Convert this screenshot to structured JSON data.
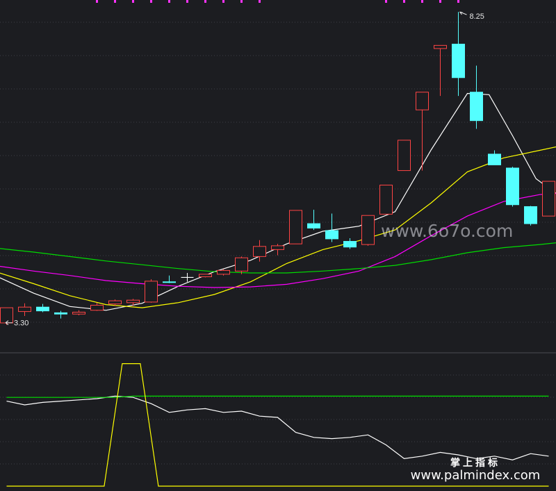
{
  "chart_data": [
    {
      "type": "candlestick",
      "panel": "price",
      "ylim": [
        3.0,
        8.35
      ],
      "grid": true,
      "annotations": {
        "high_label": "8.25",
        "low_label": "3.30",
        "high_value": 8.25,
        "low_value": 3.3
      },
      "candles": [
        {
          "o": 3.33,
          "c": 3.57,
          "h": 3.57,
          "l": 3.3
        },
        {
          "o": 3.51,
          "c": 3.58,
          "h": 3.64,
          "l": 3.44
        },
        {
          "o": 3.58,
          "c": 3.52,
          "h": 3.63,
          "l": 3.5
        },
        {
          "o": 3.49,
          "c": 3.47,
          "h": 3.52,
          "l": 3.4
        },
        {
          "o": 3.47,
          "c": 3.5,
          "h": 3.53,
          "l": 3.45
        },
        {
          "o": 3.53,
          "c": 3.61,
          "h": 3.65,
          "l": 3.52
        },
        {
          "o": 3.63,
          "c": 3.68,
          "h": 3.7,
          "l": 3.6
        },
        {
          "o": 3.65,
          "c": 3.69,
          "h": 3.71,
          "l": 3.6
        },
        {
          "o": 3.66,
          "c": 3.99,
          "h": 4.02,
          "l": 3.65
        },
        {
          "o": 3.98,
          "c": 3.97,
          "h": 4.08,
          "l": 3.96
        },
        {
          "o": 4.05,
          "c": 4.05,
          "h": 4.12,
          "l": 3.98
        },
        {
          "o": 4.06,
          "c": 4.1,
          "h": 4.1,
          "l": 4.05
        },
        {
          "o": 4.1,
          "c": 4.16,
          "h": 4.18,
          "l": 4.08
        },
        {
          "o": 4.15,
          "c": 4.36,
          "h": 4.38,
          "l": 4.1
        },
        {
          "o": 4.38,
          "c": 4.54,
          "h": 4.64,
          "l": 4.3
        },
        {
          "o": 4.49,
          "c": 4.55,
          "h": 4.58,
          "l": 4.4
        },
        {
          "o": 4.58,
          "c": 5.11,
          "h": 5.11,
          "l": 4.58
        },
        {
          "o": 4.9,
          "c": 4.83,
          "h": 5.12,
          "l": 4.8
        },
        {
          "o": 4.79,
          "c": 4.66,
          "h": 5.06,
          "l": 4.61
        },
        {
          "o": 4.62,
          "c": 4.53,
          "h": 4.67,
          "l": 4.5
        },
        {
          "o": 4.57,
          "c": 5.03,
          "h": 5.03,
          "l": 4.55
        },
        {
          "o": 5.05,
          "c": 5.51,
          "h": 5.51,
          "l": 5.05
        },
        {
          "o": 5.74,
          "c": 6.22,
          "h": 6.22,
          "l": 5.74
        },
        {
          "o": 6.7,
          "c": 6.98,
          "h": 6.98,
          "l": 5.74
        },
        {
          "o": 7.67,
          "c": 7.72,
          "h": 7.72,
          "l": 6.92
        },
        {
          "o": 7.74,
          "c": 7.21,
          "h": 8.25,
          "l": 6.92
        },
        {
          "o": 6.98,
          "c": 6.53,
          "h": 7.4,
          "l": 6.4
        },
        {
          "o": 6.0,
          "c": 5.83,
          "h": 6.06,
          "l": 5.83
        },
        {
          "o": 5.78,
          "c": 5.2,
          "h": 5.8,
          "l": 5.17
        },
        {
          "o": 5.17,
          "c": 4.9,
          "h": 5.18,
          "l": 4.87
        },
        {
          "o": 5.02,
          "c": 5.57,
          "h": 5.57,
          "l": 5.02
        }
      ],
      "ma": [
        {
          "color": "#ffffff",
          "points": [
            [
              -0.5,
              4.06
            ],
            [
              1.5,
              3.8
            ],
            [
              3.5,
              3.59
            ],
            [
              5.5,
              3.53
            ],
            [
              7.5,
              3.64
            ],
            [
              9.5,
              3.91
            ],
            [
              11.5,
              4.14
            ],
            [
              13.5,
              4.32
            ],
            [
              15.5,
              4.58
            ],
            [
              17.5,
              4.78
            ],
            [
              19.5,
              4.86
            ],
            [
              21.5,
              5.09
            ],
            [
              23.5,
              6.07
            ],
            [
              25.5,
              6.96
            ],
            [
              26.7,
              6.94
            ],
            [
              28.0,
              6.29
            ],
            [
              29.3,
              5.61
            ],
            [
              30.5,
              5.36
            ]
          ]
        },
        {
          "color": "#ffff00",
          "points": [
            [
              -0.5,
              4.13
            ],
            [
              1.5,
              3.95
            ],
            [
              3.5,
              3.76
            ],
            [
              5.5,
              3.62
            ],
            [
              7.5,
              3.57
            ],
            [
              9.5,
              3.65
            ],
            [
              11.5,
              3.78
            ],
            [
              13.5,
              3.98
            ],
            [
              15.5,
              4.27
            ],
            [
              17.5,
              4.49
            ],
            [
              19.5,
              4.63
            ],
            [
              21.5,
              4.8
            ],
            [
              23.5,
              5.23
            ],
            [
              25.5,
              5.72
            ],
            [
              27.5,
              5.94
            ],
            [
              29.5,
              6.06
            ],
            [
              30.5,
              6.12
            ]
          ]
        },
        {
          "color": "#ff00ff",
          "points": [
            [
              -0.5,
              4.23
            ],
            [
              1.5,
              4.15
            ],
            [
              3.5,
              4.08
            ],
            [
              5.5,
              4.0
            ],
            [
              7.5,
              3.95
            ],
            [
              9.5,
              3.91
            ],
            [
              11.5,
              3.89
            ],
            [
              13.5,
              3.9
            ],
            [
              15.5,
              3.94
            ],
            [
              17.5,
              4.03
            ],
            [
              19.5,
              4.15
            ],
            [
              21.5,
              4.38
            ],
            [
              23.5,
              4.71
            ],
            [
              25.5,
              5.02
            ],
            [
              27.5,
              5.25
            ],
            [
              29.5,
              5.36
            ],
            [
              30.5,
              5.38
            ]
          ]
        },
        {
          "color": "#00dd00",
          "points": [
            [
              -0.5,
              4.51
            ],
            [
              1.5,
              4.45
            ],
            [
              3.5,
              4.38
            ],
            [
              5.5,
              4.31
            ],
            [
              7.5,
              4.25
            ],
            [
              9.5,
              4.19
            ],
            [
              11.5,
              4.14
            ],
            [
              13.5,
              4.12
            ],
            [
              15.5,
              4.12
            ],
            [
              17.5,
              4.15
            ],
            [
              19.5,
              4.19
            ],
            [
              21.5,
              4.24
            ],
            [
              23.5,
              4.33
            ],
            [
              25.5,
              4.44
            ],
            [
              27.5,
              4.52
            ],
            [
              29.5,
              4.57
            ],
            [
              30.5,
              4.6
            ]
          ]
        }
      ]
    },
    {
      "type": "line",
      "panel": "indicator",
      "ylim": [
        0,
        100
      ],
      "grid": true,
      "series": [
        {
          "color": "#ffffff",
          "values": [
            [
              0,
              68
            ],
            [
              1,
              65
            ],
            [
              2,
              67
            ],
            [
              3,
              68
            ],
            [
              4,
              69
            ],
            [
              5,
              70
            ],
            [
              6,
              72
            ],
            [
              7,
              71
            ],
            [
              8,
              66
            ],
            [
              9,
              59
            ],
            [
              10,
              61
            ],
            [
              11,
              62
            ],
            [
              12,
              59
            ],
            [
              13,
              60
            ],
            [
              14,
              56
            ],
            [
              15,
              55
            ],
            [
              16,
              43
            ],
            [
              17,
              39
            ],
            [
              18,
              38
            ],
            [
              19,
              39
            ],
            [
              20,
              41
            ],
            [
              21,
              33
            ],
            [
              22,
              22
            ],
            [
              23,
              24
            ],
            [
              24,
              27
            ],
            [
              25,
              25
            ],
            [
              26,
              22
            ],
            [
              27,
              24
            ],
            [
              28,
              21
            ],
            [
              29,
              26
            ],
            [
              30,
              24
            ]
          ]
        },
        {
          "color": "#00dd00",
          "values": [
            [
              0,
              71
            ],
            [
              6,
              71
            ],
            [
              7,
              72
            ],
            [
              30,
              72
            ]
          ]
        },
        {
          "color": "#ffff00",
          "values": [
            [
              0,
              0
            ],
            [
              5.4,
              0
            ],
            [
              6.4,
              98
            ],
            [
              7.4,
              98
            ],
            [
              8.4,
              0
            ],
            [
              30,
              0
            ]
          ]
        }
      ]
    }
  ],
  "watermark": "www.6o7o.com",
  "footer": {
    "line1": "掌上指标",
    "line2": "www.palmindex.com"
  }
}
